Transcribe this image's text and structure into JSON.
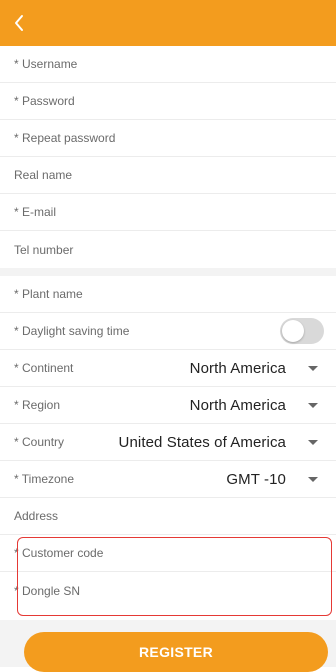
{
  "colors": {
    "accent": "#F39C1E",
    "highlight": "#e53935"
  },
  "header": {
    "back_icon": "chevron-left-icon"
  },
  "account": {
    "username": "* Username",
    "password": "* Password",
    "repeat_password": "* Repeat password",
    "real_name": "Real name",
    "email": "* E-mail",
    "tel_number": "Tel number"
  },
  "plant": {
    "plant_name": "* Plant name",
    "daylight_saving": "* Daylight saving time",
    "daylight_saving_on": false,
    "continent": {
      "label": "* Continent",
      "value": "North America"
    },
    "region": {
      "label": "* Region",
      "value": "North America"
    },
    "country": {
      "label": "* Country",
      "value": "United States of America"
    },
    "timezone": {
      "label": "* Timezone",
      "value": "GMT -10"
    },
    "address": "Address",
    "customer_code": "* Customer code",
    "dongle_sn": "* Dongle SN"
  },
  "register_label": "REGISTER"
}
